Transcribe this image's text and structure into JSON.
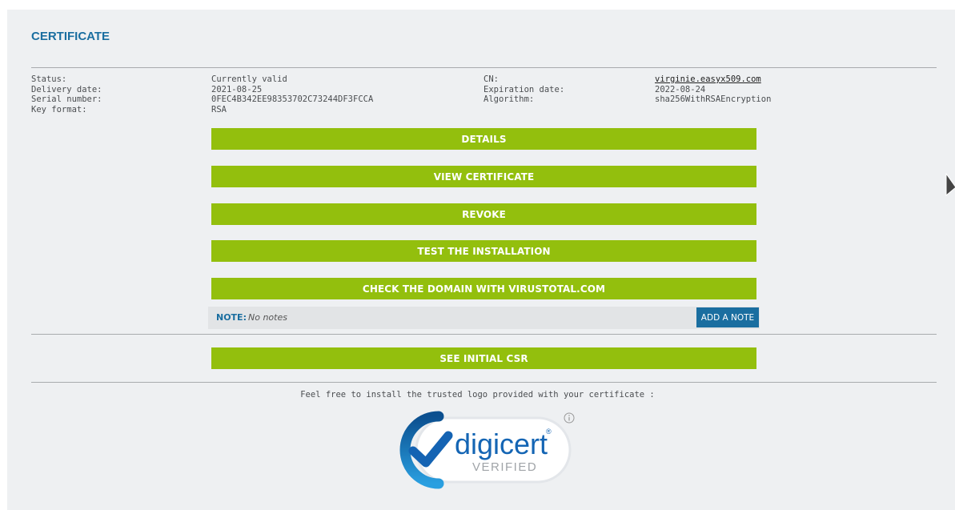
{
  "page": {
    "title": "CERTIFICATE"
  },
  "cert": {
    "left_labels": [
      "Status:",
      "Delivery date:",
      "Serial number:",
      "Key format:"
    ],
    "left_values": [
      "Currently valid",
      "2021-08-25",
      "0FEC4B342EE98353702C73244DF3FCCA",
      "RSA"
    ],
    "right_labels": [
      "CN:",
      "Expiration date:",
      "Algorithm:"
    ],
    "right_values": [
      "virginie.easyx509.com",
      "2022-08-24",
      "sha256WithRSAEncryption"
    ]
  },
  "actions": {
    "details": "DETAILS",
    "view_certificate": "VIEW CERTIFICATE",
    "revoke": "REVOKE",
    "test_installation": "TEST THE INSTALLATION",
    "check_domain": "CHECK THE DOMAIN WITH VIRUSTOTAL.COM",
    "see_csr": "SEE INITIAL CSR"
  },
  "note": {
    "label": "NOTE:",
    "value": "No notes",
    "add_button": "ADD A NOTE"
  },
  "logo": {
    "caption": "Feel free to install the trusted logo provided with your certificate :",
    "brand": "digicert",
    "sub": "VERIFIED",
    "registered": "®"
  },
  "colors": {
    "accent": "#1a6ea0",
    "button": "#93bf0d",
    "panel": "#eef0f2"
  },
  "icons": {
    "info": "info-circle-icon",
    "cursor": "mouse-pointer-icon",
    "check": "checkmark-icon"
  }
}
